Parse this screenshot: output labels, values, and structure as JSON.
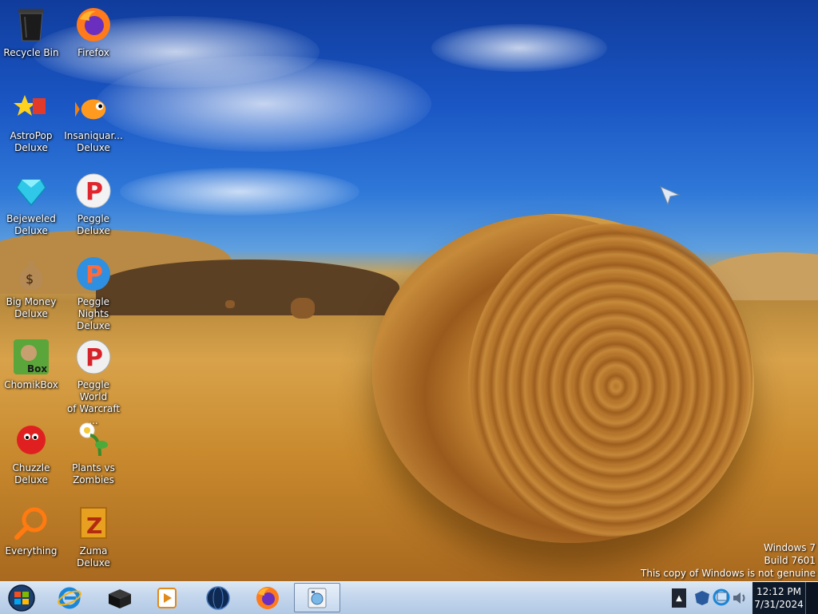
{
  "desktop": {
    "icons": [
      {
        "label": "Recycle Bin",
        "icon": "recycle-bin-icon"
      },
      {
        "label": "Firefox",
        "icon": "firefox-icon"
      },
      {
        "label": "AstroPop\nDeluxe",
        "icon": "astropop-icon"
      },
      {
        "label": "Insaniquar...\nDeluxe",
        "icon": "insaniquarium-icon"
      },
      {
        "label": "Bejeweled\nDeluxe",
        "icon": "bejeweled-icon"
      },
      {
        "label": "Peggle Deluxe",
        "icon": "peggle-icon"
      },
      {
        "label": "Big Money\nDeluxe",
        "icon": "big-money-icon"
      },
      {
        "label": "Peggle Nights\nDeluxe",
        "icon": "peggle-nights-icon"
      },
      {
        "label": "ChomikBox",
        "icon": "chomikbox-icon"
      },
      {
        "label": "Peggle World\nof Warcraft ...",
        "icon": "peggle-wow-icon"
      },
      {
        "label": "Chuzzle\nDeluxe",
        "icon": "chuzzle-icon"
      },
      {
        "label": "Plants vs\nZombies",
        "icon": "plants-vs-zombies-icon"
      },
      {
        "label": "Everything",
        "icon": "everything-search-icon"
      },
      {
        "label": "Zuma Deluxe",
        "icon": "zuma-icon"
      }
    ],
    "watermark": {
      "line1": "Windows 7",
      "line2": "Build 7601",
      "line3": "This copy of Windows is not genuine"
    }
  },
  "taskbar": {
    "pinned": [
      {
        "name": "internet-explorer-icon"
      },
      {
        "name": "black-box-app-icon"
      },
      {
        "name": "media-player-icon"
      },
      {
        "name": "globe-app-icon"
      },
      {
        "name": "firefox-icon"
      },
      {
        "name": "control-panel-icon",
        "active": true
      }
    ],
    "clock": {
      "time": "12:12 PM",
      "date": "7/31/2024"
    }
  },
  "colors": {
    "taskbar": "#c3d6ec",
    "sky": "#1a56c4",
    "field": "#c98a2e"
  }
}
